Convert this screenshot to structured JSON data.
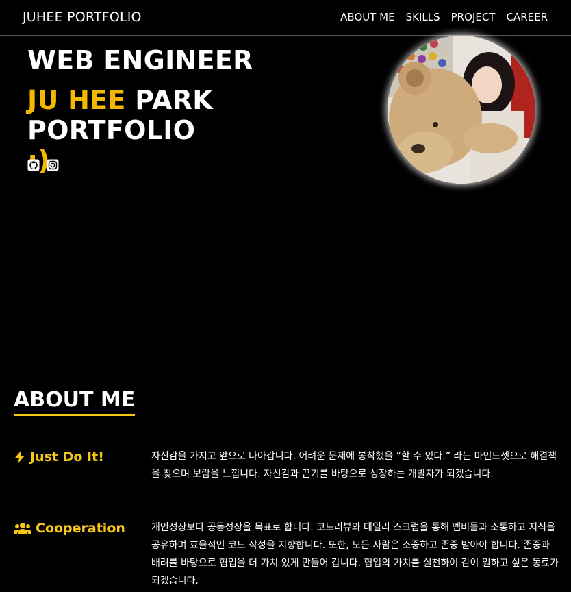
{
  "nav": {
    "brand": "JUHEE PORTFOLIO",
    "items": [
      {
        "label": "ABOUT ME"
      },
      {
        "label": "SKILLS"
      },
      {
        "label": "PROJECT"
      },
      {
        "label": "CAREER"
      }
    ]
  },
  "hero": {
    "title_line1": "WEB ENGINEER",
    "name_highlight": "JU HEE",
    "name_rest": " PARK PORTFOLIO",
    "smile": ":)",
    "social_icons": [
      "github-icon",
      "instagram-icon"
    ]
  },
  "about": {
    "heading": "ABOUT ME",
    "items": [
      {
        "icon": "lightning-icon",
        "title": "Just Do It!",
        "text": "자신감을 가지고 앞으로 나아갑니다. 어려운 문제에 봉착했을 “할 수 있다.” 라는 마인드셋으로 해결책을 찾으며 보람을 느낍니다. 자신감과 끈기를 바탕으로 성장하는 개발자가 되겠습니다."
      },
      {
        "icon": "users-icon",
        "title": "Cooperation",
        "text": "개인성장보다 공동성장을 목표로 합니다. 코드리뷰와 데일리 스크럼을 통해 멤버들과 소통하고 지식을 공유하며 효율적인 코드 작성을 지향합니다. 또한, 모든 사람은 소중하고 존중 받아야 합니다. 존중과 배려를 바탕으로 협업을 더 가치 있게 만들어 갑니다. 협업의 가치를 실천하여 같이 일하고 싶은 동료가 되겠습니다."
      }
    ]
  },
  "colors": {
    "accent": "#f5b800",
    "underline": "#f5c518",
    "background": "#000000"
  }
}
